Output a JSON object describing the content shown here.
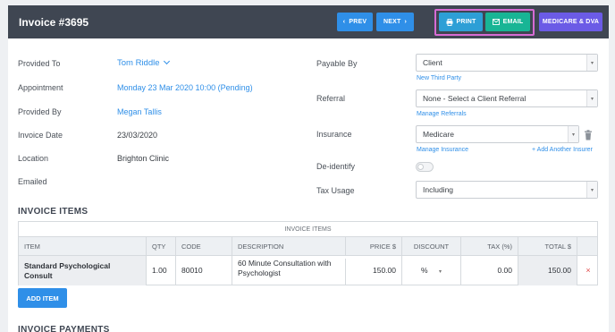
{
  "header": {
    "title": "Invoice #3695",
    "prev_label": "PREV",
    "next_label": "NEXT",
    "print_label": "PRINT",
    "email_label": "EMAIL",
    "medicare_label": "MEDICARE & DVA"
  },
  "details": {
    "provided_to_label": "Provided To",
    "provided_to_value": "Tom Riddle",
    "appointment_label": "Appointment",
    "appointment_value": "Monday 23 Mar 2020 10:00 (Pending)",
    "provided_by_label": "Provided By",
    "provided_by_value": "Megan Tallis",
    "invoice_date_label": "Invoice Date",
    "invoice_date_value": "23/03/2020",
    "location_label": "Location",
    "location_value": "Brighton Clinic",
    "emailed_label": "Emailed"
  },
  "billing": {
    "payable_by_label": "Payable By",
    "payable_by_value": "Client",
    "new_third_party": "New Third Party",
    "referral_label": "Referral",
    "referral_value": "None - Select a Client Referral",
    "manage_referrals": "Manage Referrals",
    "insurance_label": "Insurance",
    "insurance_value": "Medicare",
    "manage_insurance": "Manage Insurance",
    "add_insurer": "+ Add Another Insurer",
    "deidentify_label": "De-identify",
    "deidentify_on": false,
    "tax_usage_label": "Tax Usage",
    "tax_usage_value": "Including"
  },
  "items": {
    "section_title": "INVOICE ITEMS",
    "caption": "INVOICE ITEMS",
    "columns": [
      "ITEM",
      "QTY",
      "CODE",
      "DESCRIPTION",
      "PRICE $",
      "DISCOUNT",
      "TAX (%)",
      "TOTAL $"
    ],
    "rows": [
      {
        "item": "Standard Psychological Consult",
        "qty": "1.00",
        "code": "80010",
        "description": "60 Minute Consultation with Psychologist",
        "price": "150.00",
        "discount": "%",
        "tax": "0.00",
        "total": "150.00",
        "delete": "×"
      }
    ],
    "add_label": "ADD ITEM"
  },
  "payments": {
    "section_title": "INVOICE PAYMENTS"
  },
  "colors": {
    "header_bg": "#3f4652",
    "primary": "#2f8fe8",
    "print": "#2d9fd6",
    "email": "#18b595",
    "medicare": "#6b5be6",
    "highlight": "#d76bd4"
  }
}
